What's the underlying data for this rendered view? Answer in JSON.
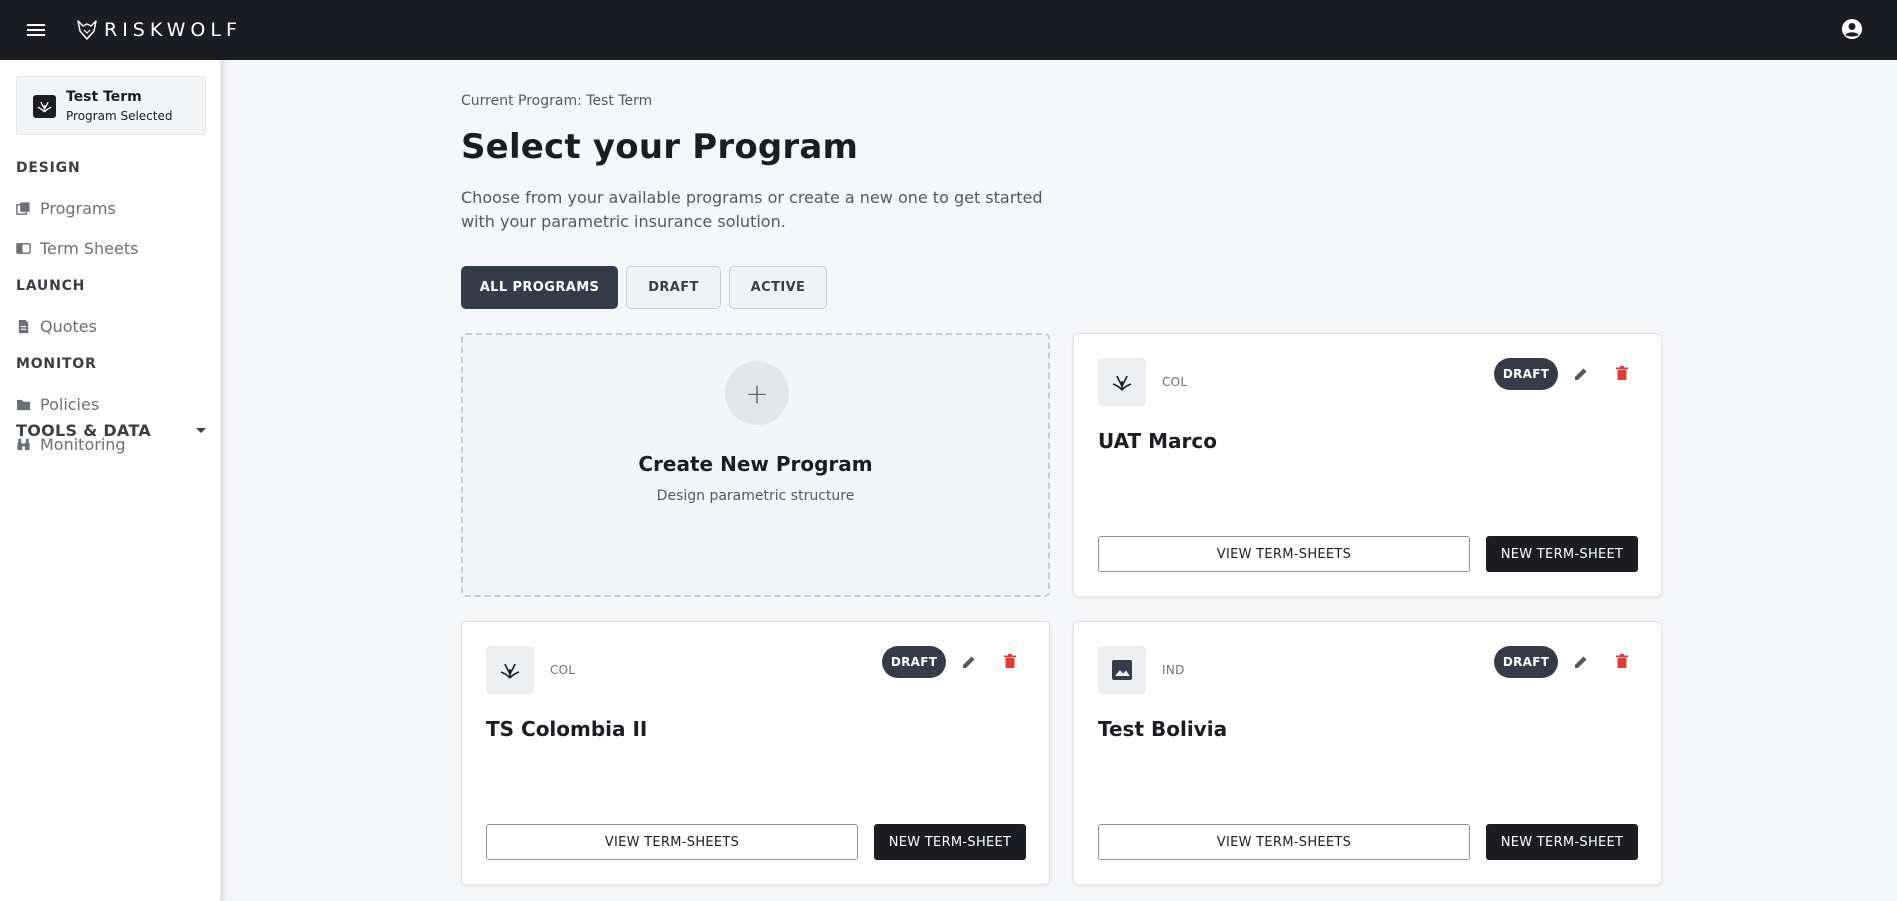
{
  "app": {
    "logo_text": "RISKWOLF"
  },
  "sidebar": {
    "current_program": {
      "name": "Test Term",
      "status": "Program Selected"
    },
    "sections": [
      {
        "title": "DESIGN"
      },
      {
        "title": "LAUNCH"
      },
      {
        "title": "MONITOR"
      }
    ],
    "items": [
      {
        "label": "Programs",
        "icon": "programs-icon"
      },
      {
        "label": "Term Sheets",
        "icon": "term-sheets-icon"
      },
      {
        "label": "Quotes",
        "icon": "document-icon"
      },
      {
        "label": "Policies",
        "icon": "folder-icon"
      },
      {
        "label": "Monitoring",
        "icon": "binoculars-icon"
      }
    ],
    "tools": {
      "label": "TOOLS & DATA"
    }
  },
  "main": {
    "breadcrumb": "Current Program: Test Term",
    "title": "Select your Program",
    "description": "Choose from your available programs or create a new one to get started with your parametric insurance solution.",
    "tabs": [
      {
        "label": "ALL PROGRAMS",
        "active": true
      },
      {
        "label": "DRAFT",
        "active": false
      },
      {
        "label": "ACTIVE",
        "active": false
      }
    ],
    "create_card": {
      "plus": "+",
      "title": "Create New Program",
      "subtitle": "Design parametric structure"
    },
    "programs": [
      {
        "name": "UAT Marco",
        "country": "COL",
        "status": "DRAFT",
        "thumb": "plant-icon",
        "view_label": "VIEW TERM-SHEETS",
        "new_label": "NEW TERM-SHEET"
      },
      {
        "name": "TS Colombia II",
        "country": "COL",
        "status": "DRAFT",
        "thumb": "plant-icon",
        "view_label": "VIEW TERM-SHEETS",
        "new_label": "NEW TERM-SHEET"
      },
      {
        "name": "Test Bolivia",
        "country": "IND",
        "status": "DRAFT",
        "thumb": "image-icon",
        "view_label": "VIEW TERM-SHEETS",
        "new_label": "NEW TERM-SHEET"
      }
    ]
  },
  "colors": {
    "topbar": "#1b1d22",
    "primary": "#353b49",
    "danger": "#e53935",
    "background": "#f6f7f9"
  }
}
